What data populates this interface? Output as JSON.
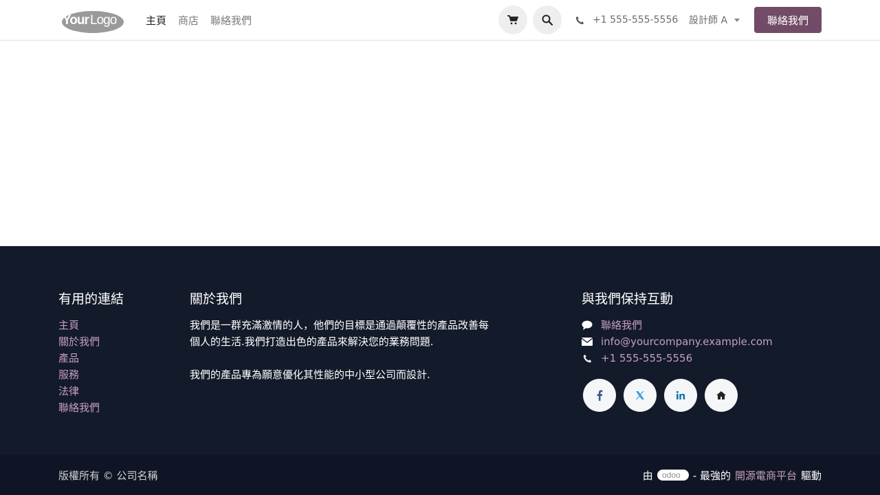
{
  "header": {
    "logo_text": "YourLogo",
    "nav": [
      {
        "label": "主頁",
        "active": true
      },
      {
        "label": "商店",
        "active": false
      },
      {
        "label": "聯絡我們",
        "active": false
      }
    ],
    "cart_icon": "cart-icon",
    "search_icon": "search-icon",
    "phone": "+1 555-555-5556",
    "user": "設計師 A",
    "cta_label": "聯絡我們"
  },
  "footer": {
    "links": {
      "title": "有用的連結",
      "items": [
        "主頁",
        "關於我們",
        "產品",
        "服務",
        "法律",
        "聯絡我們"
      ]
    },
    "about": {
      "title": "關於我們",
      "paragraph1": "我們是一群充滿激情的人，他們的目標是通過顛覆性的產品改善每個人的生活.我們打造出色的產品來解決您的業務問題.",
      "paragraph2": "我們的產品專為願意優化其性能的中小型公司而設計."
    },
    "contact": {
      "title": "與我們保持互動",
      "contact_label": "聯絡我們",
      "email": "info@yourcompany.example.com",
      "phone": "+1 555-555-5556",
      "social": [
        "facebook-icon",
        "x-twitter-icon",
        "linkedin-icon",
        "home-icon"
      ]
    }
  },
  "copyright": {
    "text": "版權所有 © 公司名稱",
    "by": "由",
    "brand": "odoo",
    "dash": "- 最強的",
    "platform": "開源電商平台",
    "powered": "驅動"
  },
  "colors": {
    "accent": "#714b67",
    "footer_bg": "#131a2a",
    "link": "#c59fbd"
  }
}
